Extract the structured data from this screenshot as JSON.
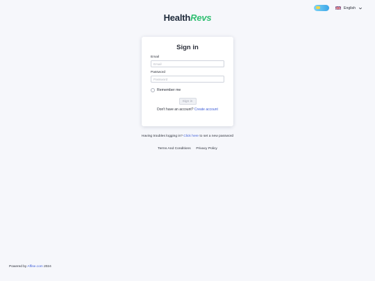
{
  "header": {
    "logo_part1": "Health",
    "logo_part2": "Revs",
    "language": "English"
  },
  "signin": {
    "title": "Sign in",
    "email_label": "Email",
    "email_placeholder": "Email",
    "email_value": "",
    "password_label": "Password",
    "password_placeholder": "Password",
    "password_value": "",
    "remember_label": "Remember me",
    "submit_label": "Sign in",
    "no_account_text": "Don't have an account?",
    "create_account_link": "Create account"
  },
  "trouble": {
    "text_before": "Having troubles logging in?",
    "link": "Click here",
    "text_after": "to set a new password"
  },
  "footer": {
    "terms": "Terms And Conditions",
    "privacy": "Privacy Policy",
    "powered_prefix": "Powered by",
    "powered_link": "Affise.com",
    "year": "2024"
  },
  "colors": {
    "accent_link": "#3b5bd6",
    "logo_green": "#2fbf71",
    "background": "#f6f7fb"
  }
}
